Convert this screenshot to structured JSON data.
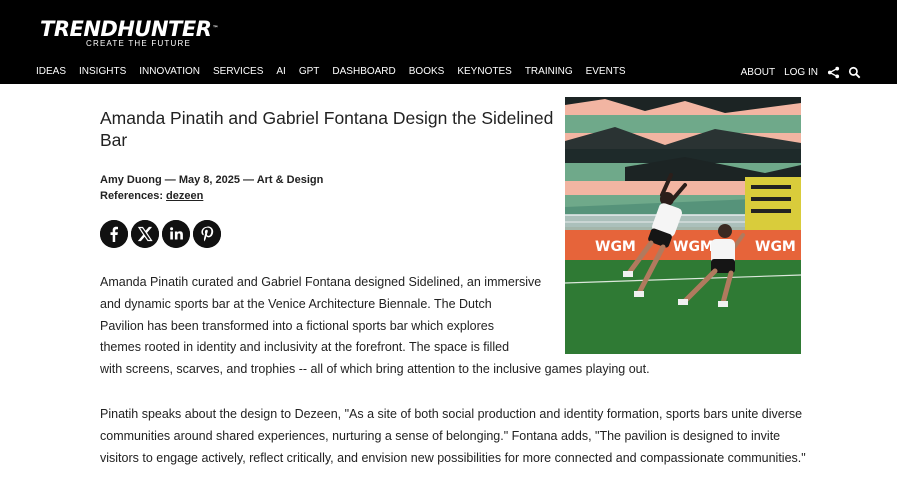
{
  "brand": {
    "logo_text": "TRENDHUNTER",
    "logo_tm": "™",
    "tagline": "CREATE THE FUTURE"
  },
  "nav": {
    "left": [
      "IDEAS",
      "INSIGHTS",
      "INNOVATION",
      "SERVICES",
      "AI",
      "GPT",
      "DASHBOARD",
      "BOOKS",
      "KEYNOTES",
      "TRAINING",
      "EVENTS"
    ],
    "right": [
      "ABOUT",
      "LOG IN"
    ],
    "icons": [
      "share-icon",
      "search-icon"
    ]
  },
  "article": {
    "title": "Amanda Pinatih and Gabriel Fontana Design the Sidelined Bar",
    "byline": "Amy Duong — May 8, 2025 — Art & Design",
    "references_label": "References: ",
    "references_link": "dezeen",
    "social": [
      "facebook-icon",
      "x-icon",
      "linkedin-icon",
      "pinterest-icon"
    ],
    "para1_lines": [
      "Amanda Pinatih curated and Gabriel Fontana designed Sidelined, an immersive",
      "and dynamic sports bar at the Venice Architecture Biennale. The Dutch",
      "Pavilion has been transformed into a fictional sports bar which explores",
      "themes rooted in identity and inclusivity at the forefront. The space is filled"
    ],
    "para1_last": "with screens, scarves, and trophies -- all of which bring attention to the inclusive games playing out.",
    "para2": "Pinatih speaks about the design to Dezeen, \"As a site of both social production and identity formation, sports bars unite diverse communities around shared experiences, nurturing a sense of belonging.\" Fontana adds, \"The pavilion is designed to invite visitors to engage actively, reflect critically, and envision new possibilities for more connected and compassionate communities.\"",
    "image_banner_texts": [
      "WGM",
      "WGM",
      "WGM"
    ]
  }
}
